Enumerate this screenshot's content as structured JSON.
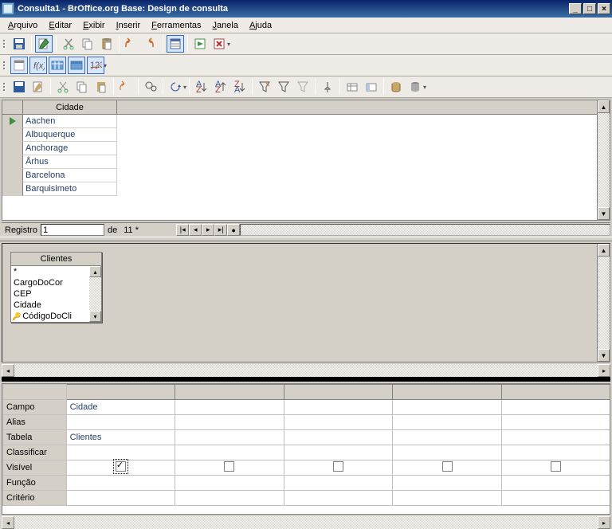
{
  "window": {
    "title": "Consulta1 - BrOffice.org Base: Design de consulta"
  },
  "menu": [
    "Arquivo",
    "Editar",
    "Exibir",
    "Inserir",
    "Ferramentas",
    "Janela",
    "Ajuda"
  ],
  "result": {
    "column": "Cidade",
    "rows": [
      "Aachen",
      "Albuquerque",
      "Anchorage",
      "Århus",
      "Barcelona",
      "Barquisimeto"
    ]
  },
  "nav": {
    "label": "Registro",
    "value": "1",
    "of": "de",
    "total": "11 *"
  },
  "table_box": {
    "title": "Clientes",
    "fields": [
      "*",
      "CargoDoCor",
      "CEP",
      "Cidade",
      "CódigoDoCli"
    ]
  },
  "criteria": {
    "rows": [
      "Campo",
      "Alias",
      "Tabela",
      "Classificar",
      "Visível",
      "Função",
      "Critério"
    ],
    "campo": "Cidade",
    "tabela": "Clientes"
  }
}
